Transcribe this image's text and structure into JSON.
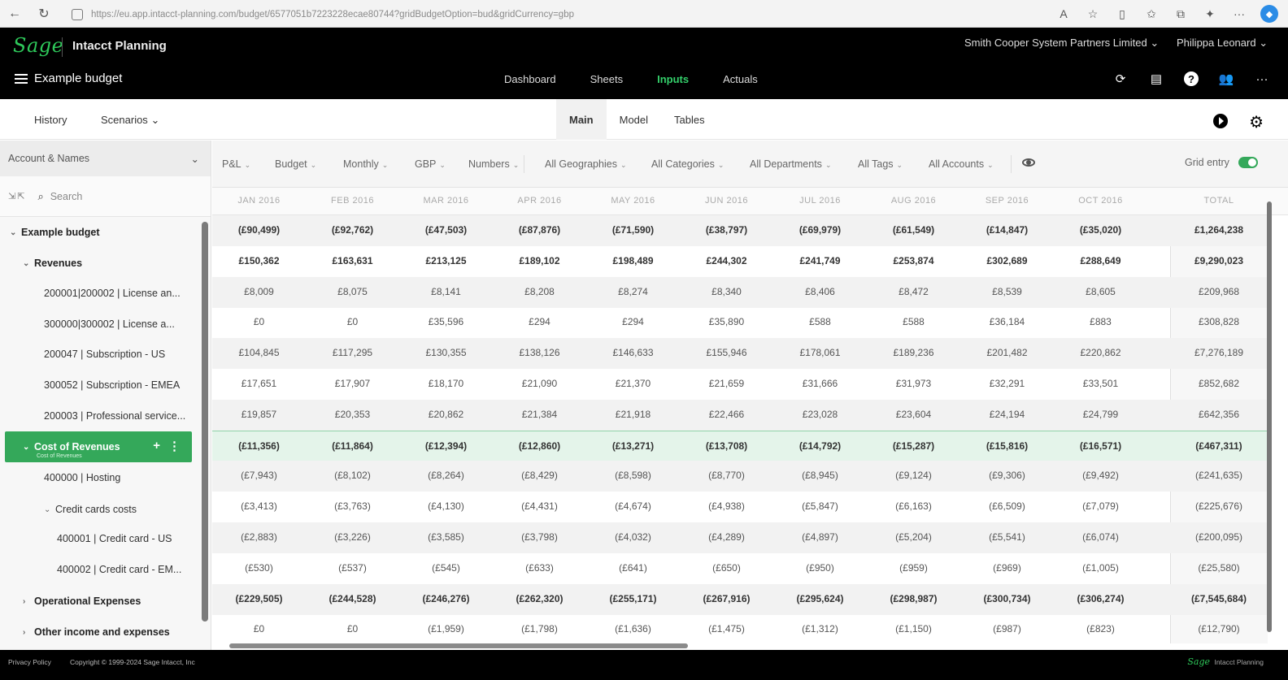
{
  "browser": {
    "url": "https://eu.app.intacct-planning.com/budget/6577051b7223228ecae80744?gridBudgetOption=bud&gridCurrency=gbp"
  },
  "header": {
    "logo": "Sage",
    "product": "Intacct Planning",
    "company": "Smith Cooper System Partners Limited",
    "user": "Philippa Leonard",
    "budget_name": "Example budget",
    "nav": [
      "Dashboard",
      "Sheets",
      "Inputs",
      "Actuals"
    ],
    "active_nav": "Inputs"
  },
  "subnav": {
    "history": "History",
    "scenarios": "Scenarios",
    "tabs": [
      "Main",
      "Model",
      "Tables"
    ],
    "active_tab": "Main"
  },
  "left_panel": {
    "header": "Account & Names",
    "search_placeholder": "Search",
    "tree": [
      {
        "label": "Example budget",
        "level": 0,
        "bold": true,
        "caret": "⌄"
      },
      {
        "label": "Revenues",
        "level": 1,
        "bold": true,
        "caret": "⌄"
      },
      {
        "label": "200001|200002 | License an...",
        "level": 2,
        "bold": false,
        "caret": ""
      },
      {
        "label": "300000|300002 | License a...",
        "level": 2,
        "bold": false,
        "caret": ""
      },
      {
        "label": "200047 | Subscription - US",
        "level": 2,
        "bold": false,
        "caret": ""
      },
      {
        "label": "300052 | Subscription - EMEA",
        "level": 2,
        "bold": false,
        "caret": ""
      },
      {
        "label": "200003 | Professional service...",
        "level": 2,
        "bold": false,
        "caret": ""
      },
      {
        "label": "Cost of Revenues",
        "level": 1,
        "bold": true,
        "caret": "⌄",
        "selected": true,
        "sub": "Cost of Revenues"
      },
      {
        "label": "400000 | Hosting",
        "level": 2,
        "bold": false,
        "caret": ""
      },
      {
        "label": "Credit cards costs",
        "level": 2,
        "bold": false,
        "caret": "⌄"
      },
      {
        "label": "400001 | Credit card - US",
        "level": 3,
        "bold": false,
        "caret": ""
      },
      {
        "label": "400002 | Credit card - EM...",
        "level": 3,
        "bold": false,
        "caret": ""
      },
      {
        "label": "Operational Expenses",
        "level": 1,
        "bold": true,
        "caret": "›"
      },
      {
        "label": "Other income and expenses",
        "level": 1,
        "bold": true,
        "caret": "›"
      }
    ]
  },
  "filters": {
    "items": [
      "P&L",
      "Budget",
      "Monthly",
      "GBP",
      "Numbers",
      "All Geographies",
      "All Categories",
      "All Departments",
      "All Tags",
      "All Accounts"
    ],
    "grid_entry": "Grid entry",
    "grid_entry_on": true
  },
  "grid": {
    "columns": [
      "JAN 2016",
      "FEB 2016",
      "MAR 2016",
      "APR 2016",
      "MAY 2016",
      "JUN 2016",
      "JUL 2016",
      "AUG 2016",
      "SEP 2016",
      "OCT 2016"
    ],
    "total_label": "TOTAL",
    "rows": [
      {
        "bold": true,
        "values": [
          "(£90,499)",
          "(£92,762)",
          "(£47,503)",
          "(£87,876)",
          "(£71,590)",
          "(£38,797)",
          "(£69,979)",
          "(£61,549)",
          "(£14,847)",
          "(£35,020)"
        ],
        "total": "£1,264,238"
      },
      {
        "bold": true,
        "values": [
          "£150,362",
          "£163,631",
          "£213,125",
          "£189,102",
          "£198,489",
          "£244,302",
          "£241,749",
          "£253,874",
          "£302,689",
          "£288,649"
        ],
        "total": "£9,290,023"
      },
      {
        "bold": false,
        "values": [
          "£8,009",
          "£8,075",
          "£8,141",
          "£8,208",
          "£8,274",
          "£8,340",
          "£8,406",
          "£8,472",
          "£8,539",
          "£8,605"
        ],
        "total": "£209,968"
      },
      {
        "bold": false,
        "values": [
          "£0",
          "£0",
          "£35,596",
          "£294",
          "£294",
          "£35,890",
          "£588",
          "£588",
          "£36,184",
          "£883"
        ],
        "total": "£308,828"
      },
      {
        "bold": false,
        "values": [
          "£104,845",
          "£117,295",
          "£130,355",
          "£138,126",
          "£146,633",
          "£155,946",
          "£178,061",
          "£189,236",
          "£201,482",
          "£220,862"
        ],
        "total": "£7,276,189"
      },
      {
        "bold": false,
        "values": [
          "£17,651",
          "£17,907",
          "£18,170",
          "£21,090",
          "£21,370",
          "£21,659",
          "£31,666",
          "£31,973",
          "£32,291",
          "£33,501"
        ],
        "total": "£852,682"
      },
      {
        "bold": false,
        "values": [
          "£19,857",
          "£20,353",
          "£20,862",
          "£21,384",
          "£21,918",
          "£22,466",
          "£23,028",
          "£23,604",
          "£24,194",
          "£24,799"
        ],
        "total": "£642,356"
      },
      {
        "bold": true,
        "selected": true,
        "values": [
          "(£11,356)",
          "(£11,864)",
          "(£12,394)",
          "(£12,860)",
          "(£13,271)",
          "(£13,708)",
          "(£14,792)",
          "(£15,287)",
          "(£15,816)",
          "(£16,571)"
        ],
        "total": "(£467,311)"
      },
      {
        "bold": false,
        "values": [
          "(£7,943)",
          "(£8,102)",
          "(£8,264)",
          "(£8,429)",
          "(£8,598)",
          "(£8,770)",
          "(£8,945)",
          "(£9,124)",
          "(£9,306)",
          "(£9,492)"
        ],
        "total": "(£241,635)"
      },
      {
        "bold": false,
        "values": [
          "(£3,413)",
          "(£3,763)",
          "(£4,130)",
          "(£4,431)",
          "(£4,674)",
          "(£4,938)",
          "(£5,847)",
          "(£6,163)",
          "(£6,509)",
          "(£7,079)"
        ],
        "total": "(£225,676)"
      },
      {
        "bold": false,
        "values": [
          "(£2,883)",
          "(£3,226)",
          "(£3,585)",
          "(£3,798)",
          "(£4,032)",
          "(£4,289)",
          "(£4,897)",
          "(£5,204)",
          "(£5,541)",
          "(£6,074)"
        ],
        "total": "(£200,095)"
      },
      {
        "bold": false,
        "values": [
          "(£530)",
          "(£537)",
          "(£545)",
          "(£633)",
          "(£641)",
          "(£650)",
          "(£950)",
          "(£959)",
          "(£969)",
          "(£1,005)"
        ],
        "total": "(£25,580)"
      },
      {
        "bold": true,
        "values": [
          "(£229,505)",
          "(£244,528)",
          "(£246,276)",
          "(£262,320)",
          "(£255,171)",
          "(£267,916)",
          "(£295,624)",
          "(£298,987)",
          "(£300,734)",
          "(£306,274)"
        ],
        "total": "(£7,545,684)"
      },
      {
        "bold": false,
        "values": [
          "£0",
          "£0",
          "(£1,959)",
          "(£1,798)",
          "(£1,636)",
          "(£1,475)",
          "(£1,312)",
          "(£1,150)",
          "(£987)",
          "(£823)"
        ],
        "total": "(£12,790)"
      }
    ]
  },
  "footer": {
    "privacy": "Privacy Policy",
    "copyright": "Copyright © 1999-2024 Sage Intacct, Inc",
    "logo": "Sage",
    "product": "Intacct Planning"
  },
  "colors": {
    "accent": "#34a85a",
    "header_bg": "#000000",
    "active_nav": "#34d06b"
  }
}
